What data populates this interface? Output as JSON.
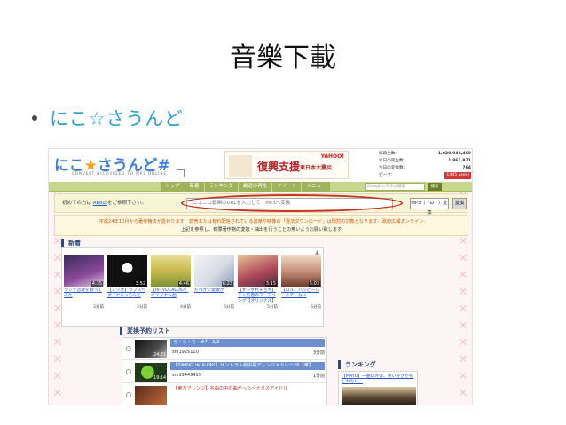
{
  "slide": {
    "title": "音樂下載",
    "bullet": "にこ☆さうんど"
  },
  "site": {
    "logo_text_a": "にこ",
    "logo_star": "★",
    "logo_text_b": "さうんど#",
    "logo_sub": "CONVERT NICOVIDEO TO MP3 ONLINE",
    "ad_title": "復興支援",
    "ad_sub": "東日本大震災",
    "ad_yahoo": "YAHOO!",
    "stats": [
      {
        "label": "総再生数:",
        "value": "1,020,946,469"
      },
      {
        "label": "今日の再生数:",
        "value": "1,861,971"
      },
      {
        "label": "今日の変換数:",
        "value": "764"
      },
      {
        "label": "ピーク:",
        "value": "1445 users"
      }
    ],
    "nav": [
      "トップ",
      "新着",
      "ランキング",
      "最近の再生",
      "ツイート",
      "メニュー"
    ],
    "search_placeholder": "Googleカスタム検索",
    "search_button": "検索",
    "help_prefix": "初めての方は",
    "help_link": "About",
    "help_suffix": "をご参照下さい。",
    "url_placeholder": "ニコニコ動画のURLを入力して・MP3へ変換",
    "mp3_button": "MP3（・ω・）変換",
    "go_button": "変換",
    "notice_line1": "平成24年10月から著作権法が変わります　前売または有料配信されている音楽や映像の「違法ダウンロード」は刑罰の対象となります：政府広報オンライン",
    "notice_line2": "上記を参照し、有罪著作物の変換・抽出を行うことの無いようお願い致します"
  },
  "new_section": {
    "heading": "新着",
    "items": [
      {
        "duration": "4:35",
        "title": "テンテ恋歌を歌ってみた",
        "views": "2分前",
        "color": "#6b3a7a"
      },
      {
        "duration": "3:52",
        "title": "【ミリオ】ラプスウダイヤまってみた",
        "views": "2分前",
        "color": "#1a1a1a"
      },
      {
        "duration": "4:46",
        "title": "【re: VOCALOID】オリジナル曲",
        "views": "4分前",
        "color": "#d7c97a"
      },
      {
        "duration": "6:23",
        "title": "だれかに愛歌が",
        "views": "5分前",
        "color": "#e8e8e8"
      },
      {
        "duration": "3:15",
        "title": "【ず～ずれチョキ】チャ気者のマーアリング【オリジナル】",
        "views": "5分前",
        "color": "#b04a5a"
      },
      {
        "duration": "5:03",
        "title": "【ロル】ハッピーバースデーなに",
        "views": "6分前",
        "color": "#c78f7a"
      }
    ]
  },
  "conversion": {
    "heading": "変換予約リスト",
    "rows": [
      {
        "title": "ら・ら・ら　#7　2/3",
        "id": "sm19251107",
        "time": "3分前",
        "duration": "24:31",
        "color": "#2a2a2a",
        "plain": false
      },
      {
        "title": "【SWING de K-ON!】サントラ＆劇中歌アレンジメドレー26【唯】",
        "id": "sm19449419",
        "time": "1分前",
        "duration": "19:14",
        "color": "#1f3b1a",
        "plain": false
      },
      {
        "title": "【東方アレンジ】名曲の中の曲がった～ナタスアイドル",
        "id": "",
        "time": "",
        "duration": "",
        "color": "#5a2a1a",
        "plain": true
      }
    ]
  },
  "ranking": {
    "heading": "ランキング",
    "text": "【MAYU】一曲以外は、笑い好きかもしれない。"
  },
  "colors": {
    "accent": "#2aa0c8",
    "nav_bg": "#c7d78c",
    "highlight": "#c0342a"
  }
}
